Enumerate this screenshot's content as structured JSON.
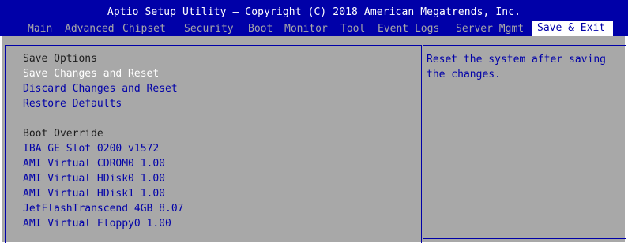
{
  "header": {
    "title": "Aptio Setup Utility – Copyright (C) 2018 American Megatrends, Inc."
  },
  "menu": {
    "items": [
      {
        "label": "Main"
      },
      {
        "label": "Advanced"
      },
      {
        "label": "Chipset"
      },
      {
        "label": "Security"
      },
      {
        "label": "Boot"
      },
      {
        "label": "Monitor"
      },
      {
        "label": "Tool"
      },
      {
        "label": "Event Logs"
      },
      {
        "label": "Server Mgmt"
      },
      {
        "label": "Save & Exit"
      }
    ],
    "active": "Save & Exit"
  },
  "save_options": {
    "heading": "Save Options",
    "items": [
      {
        "label": "Save Changes and Reset"
      },
      {
        "label": "Discard Changes and Reset"
      },
      {
        "label": "Restore Defaults"
      }
    ]
  },
  "boot_override": {
    "heading": "Boot Override",
    "items": [
      {
        "label": "IBA GE Slot 0200 v1572"
      },
      {
        "label": "AMI Virtual CDROM0 1.00"
      },
      {
        "label": "AMI Virtual HDisk0 1.00"
      },
      {
        "label": "AMI Virtual HDisk1 1.00"
      },
      {
        "label": "JetFlashTranscend 4GB 8.07"
      },
      {
        "label": "AMI Virtual Floppy0 1.00"
      }
    ]
  },
  "help_text": "Reset the system after saving the changes.",
  "colors": {
    "header_bg": "#0000a8",
    "panel_bg": "#a8a8a8",
    "item_text": "#0000a8",
    "selected_text": "#ffffff",
    "heading_text": "#1c1c1c"
  }
}
